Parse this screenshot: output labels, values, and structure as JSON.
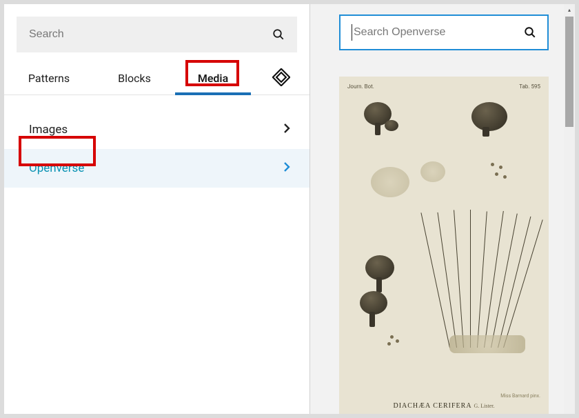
{
  "sidebar": {
    "search_placeholder": "Search",
    "tabs": {
      "patterns": "Patterns",
      "blocks": "Blocks",
      "media": "Media"
    },
    "items": [
      {
        "label": "Images"
      },
      {
        "label": "Openverse"
      }
    ]
  },
  "openverse": {
    "search_placeholder": "Search Openverse",
    "result": {
      "header_left": "Journ. Bot.",
      "header_right": "Tab. 595",
      "caption_main": "DIACHÆA CERIFERA",
      "caption_author": "G. Lister.",
      "credit": "Miss Barnard pinx."
    }
  },
  "colors": {
    "accent": "#1f8dd6",
    "highlight_border": "#d60000",
    "openverse_text": "#0891b2"
  }
}
